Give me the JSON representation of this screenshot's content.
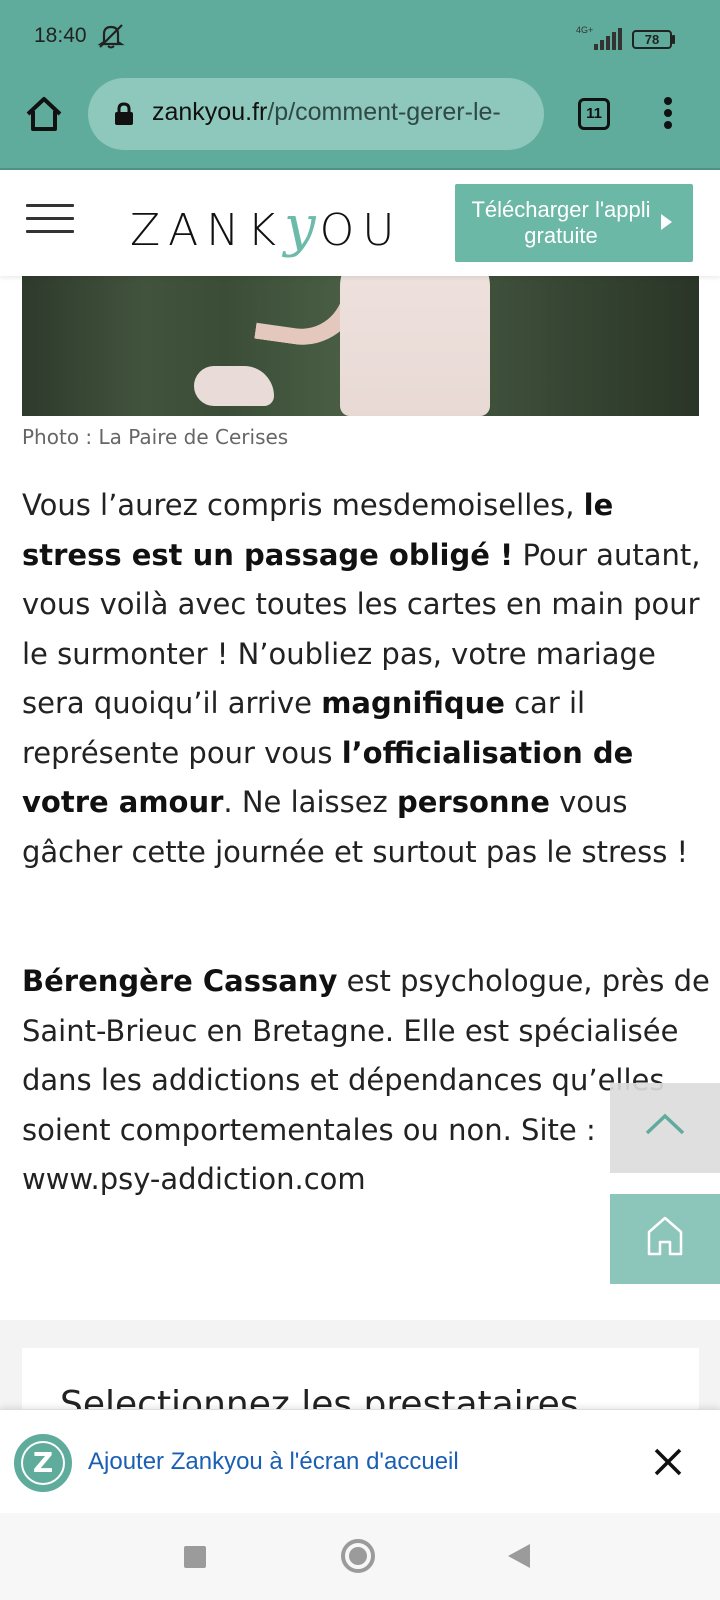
{
  "status_bar": {
    "time": "18:40",
    "network": "4G+",
    "battery": "78"
  },
  "browser": {
    "url_host": "zankyou.fr",
    "url_path": "/p/comment-gerer-le-",
    "tab_count": "11"
  },
  "site_header": {
    "logo_left": "ZANK",
    "logo_y": "y",
    "logo_right": "OU",
    "cta_label": "Télécharger l'appli gratuite"
  },
  "photo": {
    "credit": "Photo : La Paire de Cerises"
  },
  "article": {
    "p1": [
      {
        "text": "Vous l’aurez compris mesdemoiselles, ",
        "bold": false
      },
      {
        "text": "le stress est un passage obligé !",
        "bold": true
      },
      {
        "text": " Pour autant, vous voilà avec toutes les cartes en main pour le surmonter ! N’oubliez pas, votre mariage sera quoiqu’il arrive ",
        "bold": false
      },
      {
        "text": "magnifique",
        "bold": true
      },
      {
        "text": " car il représente pour vous ",
        "bold": false
      },
      {
        "text": "l’officialisation de votre amour",
        "bold": true
      },
      {
        "text": ". Ne laissez ",
        "bold": false
      },
      {
        "text": "personne",
        "bold": true
      },
      {
        "text": " vous gâcher cette journée et surtout pas le stress !",
        "bold": false
      }
    ],
    "p2": [
      {
        "text": "Bérengère Cassany",
        "bold": true
      },
      {
        "text": " est psychologue, près de Saint-Brieuc en Bretagne. Elle est spécialisée dans les addictions et dépendances qu’elles soient comportementales ou non. Site : www.psy-addiction.com",
        "bold": false
      }
    ]
  },
  "section": {
    "card_title": "Selectionnez les prestataires"
  },
  "install_banner": {
    "badge_letter": "Z",
    "text": "Ajouter Zankyou à l'écran d'accueil"
  },
  "colors": {
    "brand_teal": "#5fac9c",
    "cta_teal": "#6cb8a7",
    "link_blue": "#1a5fb4"
  },
  "icons": [
    "home-icon",
    "lock-icon",
    "tabs-icon",
    "more-vert-icon",
    "hamburger-icon",
    "play-arrow-icon",
    "chevron-up-icon",
    "house-outline-icon",
    "close-icon",
    "bell-off-icon",
    "signal-icon",
    "battery-icon"
  ]
}
